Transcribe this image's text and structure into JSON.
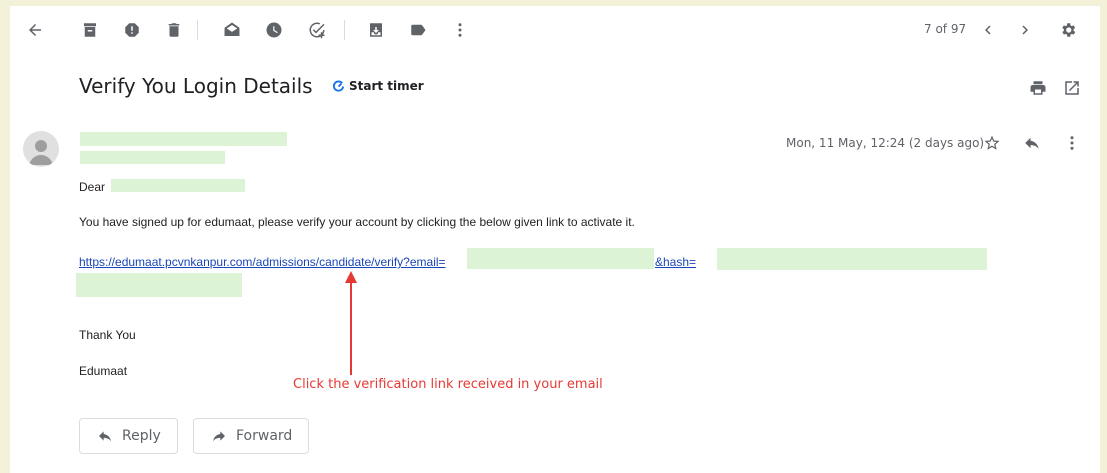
{
  "toolbar": {
    "counter": "7 of 97",
    "icons": [
      "back-arrow-icon",
      "archive-icon",
      "report-spam-icon",
      "delete-icon",
      "mark-unread-icon",
      "snooze-icon",
      "add-task-icon",
      "move-to-icon",
      "labels-icon",
      "more-vert-icon",
      "prev-chevron-icon",
      "next-chevron-icon",
      "settings-gear-icon"
    ]
  },
  "email": {
    "subject": "Verify You Login Details",
    "timer_label": "Start timer",
    "date": "Mon, 11 May, 12:24 (2 days ago)",
    "greeting": "Dear",
    "body_line": "You have signed up for edumaat, please verify your account by clicking the below given link to activate it.",
    "link_part1": "https://edumaat.pcvnkanpur.com/admissions/candidate/verify?email=",
    "link_part2": "&hash=",
    "thanks": "Thank You",
    "signature": "Edumaat"
  },
  "annotation": {
    "text": "Click the verification link received in your email",
    "color": "#e53935"
  },
  "actions": {
    "reply_label": "Reply",
    "forward_label": "Forward"
  },
  "colors": {
    "background": "#f4f1d9",
    "redaction": "#dcf3d5",
    "link": "#1a47b8"
  }
}
